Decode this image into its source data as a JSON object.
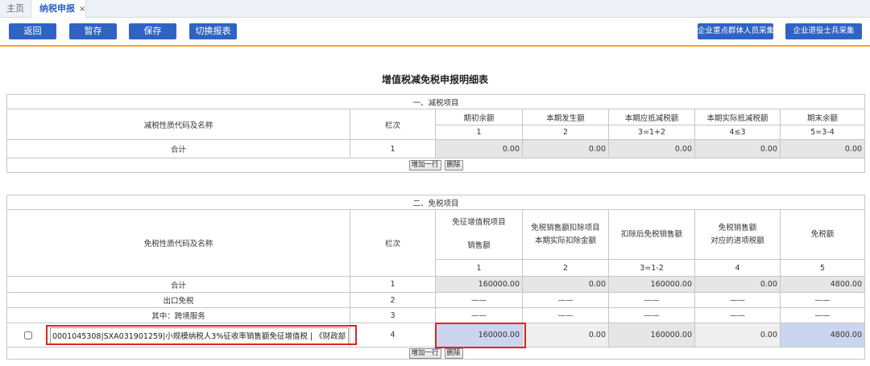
{
  "tabs": {
    "home": "主页",
    "active": "纳税申报",
    "close": "×"
  },
  "toolbar": {
    "back": "返回",
    "temp_save": "暂存",
    "save": "保存",
    "switch_report": "切换报表",
    "key_groups_collect": "企业重点群体人员采集",
    "veterans_collect": "企业退役士兵采集"
  },
  "page_title": "增值税减免税申报明细表",
  "reduction": {
    "section_title": "一、减税项目",
    "name_header": "减税性质代码及名称",
    "line_header": "栏次",
    "columns": [
      {
        "label": "期初余额",
        "code": "1"
      },
      {
        "label": "本期发生额",
        "code": "2"
      },
      {
        "label": "本期应抵减税额",
        "code": "3=1+2"
      },
      {
        "label": "本期实际抵减税额",
        "code": "4≤3"
      },
      {
        "label": "期末余额",
        "code": "5=3-4"
      }
    ],
    "rows": [
      {
        "name": "合计",
        "line": "1",
        "values": [
          "0.00",
          "0.00",
          "0.00",
          "0.00",
          "0.00"
        ]
      }
    ],
    "add_row": "增加一行",
    "delete_row": "删除"
  },
  "exemption": {
    "section_title": "二、免税项目",
    "name_header": "免税性质代码及名称",
    "line_header": "栏次",
    "columns": [
      {
        "label_lines": [
          "免征增值税项目",
          "销售额"
        ],
        "code": "1"
      },
      {
        "label_lines": [
          "免税销售额扣除项目",
          "本期实际扣除金额"
        ],
        "code": "2"
      },
      {
        "label_lines": [
          "扣除后免税销售额"
        ],
        "code": "3=1-2"
      },
      {
        "label_lines": [
          "免税销售额",
          "对应的进项税额"
        ],
        "code": "4"
      },
      {
        "label_lines": [
          "免税额"
        ],
        "code": "5"
      }
    ],
    "rows": [
      {
        "name": "合计",
        "line": "1",
        "values": [
          "160000.00",
          "0.00",
          "160000.00",
          "0.00",
          "4800.00"
        ]
      },
      {
        "name": "出口免税",
        "line": "2",
        "values": [
          "——",
          "——",
          "——",
          "——",
          "——"
        ]
      },
      {
        "name": "其中：跨境服务",
        "line": "3",
        "values": [
          "——",
          "——",
          "——",
          "——",
          "——"
        ]
      },
      {
        "checked": false,
        "name_input": "0001045308|SXA031901259|小规模纳税人3%征收率销售额免征增值税 | 《财政部 税务总局关于",
        "line": "4",
        "values": [
          "160000.00",
          "0.00",
          "160000.00",
          "0.00",
          "4800.00"
        ]
      }
    ],
    "add_row": "增加一行",
    "delete_row": "删除"
  },
  "colors": {
    "primary_button": "#2f64c4",
    "accent_line": "#f5a623",
    "readonly_cell": "#e6e6e6",
    "editable_cell": "#ccd5ef",
    "highlight_box": "#e2231a"
  }
}
